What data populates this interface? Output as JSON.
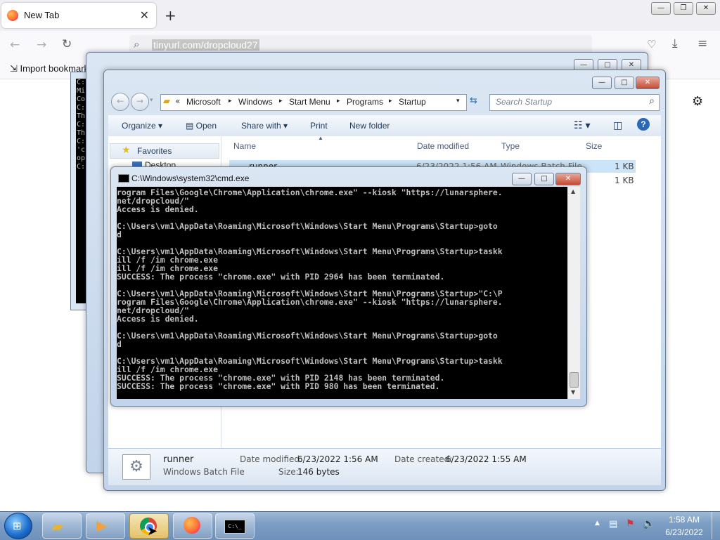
{
  "browser": {
    "tab_title": "New Tab",
    "url": "tinyurl.com/dropcloud27",
    "bookmark": "Import bookmarks..."
  },
  "bg_console": {
    "fragments": [
      "C:\\",
      "Mi",
      "Co",
      "C:",
      "Th",
      "C:",
      "Th",
      "C:",
      "'c",
      "op",
      "C:"
    ]
  },
  "explorer": {
    "breadcrumb": [
      "Microsoft",
      "Windows",
      "Start Menu",
      "Programs",
      "Startup"
    ],
    "search_placeholder": "Search Startup",
    "toolbar": {
      "organize": "Organize",
      "open": "Open",
      "share": "Share with",
      "print": "Print",
      "new_folder": "New folder"
    },
    "nav": {
      "favorites": "Favorites",
      "desktop": "Desktop"
    },
    "columns": {
      "name": "Name",
      "date": "Date modified",
      "type": "Type",
      "size": "Size"
    },
    "files": [
      {
        "name": "runner",
        "date": "6/23/2022 1:56 AM",
        "type": "Windows Batch File",
        "size": "1 KB"
      },
      {
        "size": "1 KB"
      }
    ],
    "details": {
      "name": "runner",
      "type": "Windows Batch File",
      "modified_label": "Date modified:",
      "modified": "6/23/2022 1:56 AM",
      "created_label": "Date created:",
      "created": "6/23/2022 1:55 AM",
      "size_label": "Size:",
      "size": "146 bytes"
    }
  },
  "cmd": {
    "title": "C:\\Windows\\system32\\cmd.exe",
    "lines": [
      "rogram Files\\Google\\Chrome\\Application\\chrome.exe\" --kiosk \"https://lunarsphere.",
      "net/dropcloud/\"",
      "Access is denied.",
      "",
      "C:\\Users\\vm1\\AppData\\Roaming\\Microsoft\\Windows\\Start Menu\\Programs\\Startup>goto",
      "d",
      "",
      "C:\\Users\\vm1\\AppData\\Roaming\\Microsoft\\Windows\\Start Menu\\Programs\\Startup>taskk",
      "ill /f /im chrome.exe",
      "ill /f /im chrome.exe",
      "SUCCESS: The process \"chrome.exe\" with PID 2964 has been terminated.",
      "",
      "C:\\Users\\vm1\\AppData\\Roaming\\Microsoft\\Windows\\Start Menu\\Programs\\Startup>\"C:\\P",
      "rogram Files\\Google\\Chrome\\Application\\chrome.exe\" --kiosk \"https://lunarsphere.",
      "net/dropcloud/\"",
      "Access is denied.",
      "",
      "C:\\Users\\vm1\\AppData\\Roaming\\Microsoft\\Windows\\Start Menu\\Programs\\Startup>goto",
      "d",
      "",
      "C:\\Users\\vm1\\AppData\\Roaming\\Microsoft\\Windows\\Start Menu\\Programs\\Startup>taskk",
      "ill /f /im chrome.exe",
      "SUCCESS: The process \"chrome.exe\" with PID 2148 has been terminated.",
      "SUCCESS: The process \"chrome.exe\" with PID 980 has been terminated."
    ]
  },
  "taskbar": {
    "clock_time": "1:58 AM",
    "clock_date": "6/23/2022",
    "cmd_icon_text": "C:\\_"
  },
  "colors": {
    "cmd_bg": "#000000",
    "cmd_fg": "#c0c0c0",
    "taskbar": "#7d9ec4",
    "accent": "#1e395b"
  }
}
